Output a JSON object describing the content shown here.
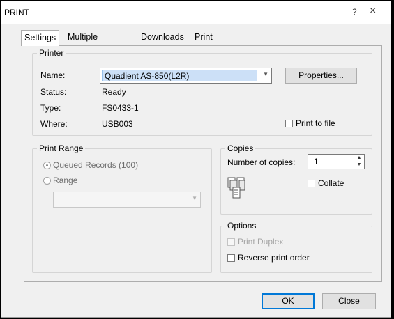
{
  "window": {
    "title": "PRINT",
    "help": "?",
    "close": "×"
  },
  "tabs": [
    "Settings",
    "Multiple Printers",
    "Downloads",
    "Print Options"
  ],
  "printer": {
    "legend": "Printer",
    "name_label": "Name:",
    "name_value": "Quadient AS-850(L2R)",
    "properties": "Properties...",
    "status_label": "Status:",
    "status_value": "Ready",
    "type_label": "Type:",
    "type_value": "FS0433-1",
    "where_label": "Where:",
    "where_value": "USB003",
    "print_to_file": "Print to file"
  },
  "range": {
    "legend": "Print Range",
    "queued": "Queued Records (100)",
    "range": "Range"
  },
  "copies": {
    "legend": "Copies",
    "number_label": "Number of copies:",
    "number_value": "1",
    "collate": "Collate"
  },
  "options": {
    "legend": "Options",
    "duplex": "Print Duplex",
    "reverse": "Reverse print order"
  },
  "footer": {
    "ok": "OK",
    "close": "Close"
  }
}
